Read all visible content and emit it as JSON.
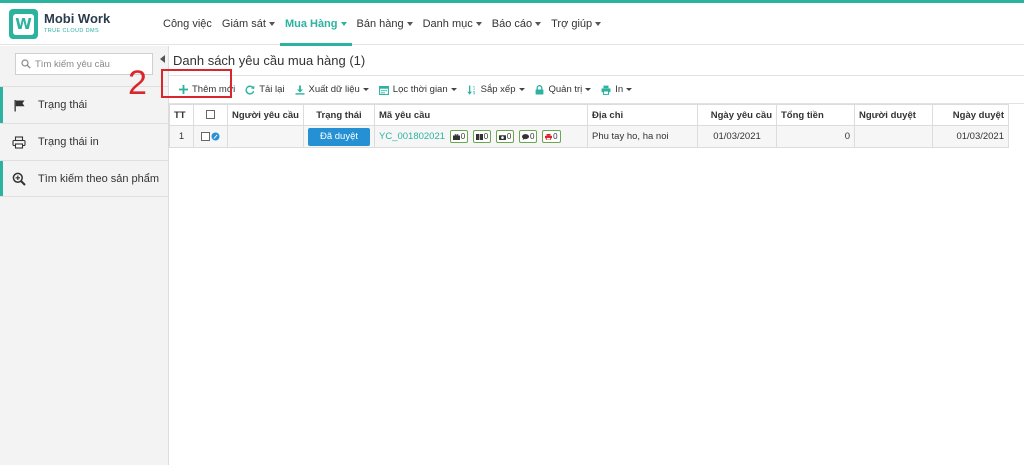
{
  "app": {
    "logo_name": "Mobi Work",
    "logo_tagline": "TRUE CLOUD DMS",
    "accent_color": "#2bb3a0",
    "status_color": "#2590d3",
    "annotation_color": "#d9262c"
  },
  "nav": {
    "items": [
      {
        "label": "Công việc",
        "has_caret": false
      },
      {
        "label": "Giám sát",
        "has_caret": true
      },
      {
        "label": "Mua Hàng",
        "has_caret": true,
        "active": true
      },
      {
        "label": "Bán hàng",
        "has_caret": true
      },
      {
        "label": "Danh mục",
        "has_caret": true
      },
      {
        "label": "Báo cáo",
        "has_caret": true
      },
      {
        "label": "Trợ giúp",
        "has_caret": true
      }
    ]
  },
  "sidebar": {
    "search_placeholder": "Tìm kiếm yêu cầu",
    "items": [
      {
        "label": "Trạng thái",
        "icon": "flag-icon"
      },
      {
        "label": "Trạng thái in",
        "icon": "printer-icon"
      },
      {
        "label": "Tìm kiếm theo sản phẩm",
        "icon": "zoom-in-icon"
      }
    ]
  },
  "main": {
    "title": "Danh sách yêu cầu mua hàng (1)",
    "step_annotation": "2",
    "toolbar": {
      "add": "Thêm mới",
      "reload": "Tải lại",
      "export": "Xuất dữ liệu",
      "filter_time": "Lọc thời gian",
      "sort": "Sắp xếp",
      "admin": "Quản trị",
      "print": "In"
    },
    "table": {
      "headers": {
        "tt": "TT",
        "requester": "Người yêu cầu",
        "status": "Trạng thái",
        "code": "Mã yêu cầu",
        "address": "Địa chỉ",
        "request_date": "Ngày yêu cầu",
        "total": "Tổng tiền",
        "approver": "Người duyệt",
        "approve_date": "Ngày duyệt"
      },
      "rows": [
        {
          "tt": "1",
          "requester": "",
          "status": "Đã duyệt",
          "code": "YC_001802021",
          "badges": [
            "0",
            "0",
            "0",
            "0",
            "0"
          ],
          "address": "Phu tay ho, ha noi",
          "request_date": "01/03/2021",
          "total": "0",
          "approver": "",
          "approve_date": "01/03/2021"
        }
      ]
    }
  }
}
